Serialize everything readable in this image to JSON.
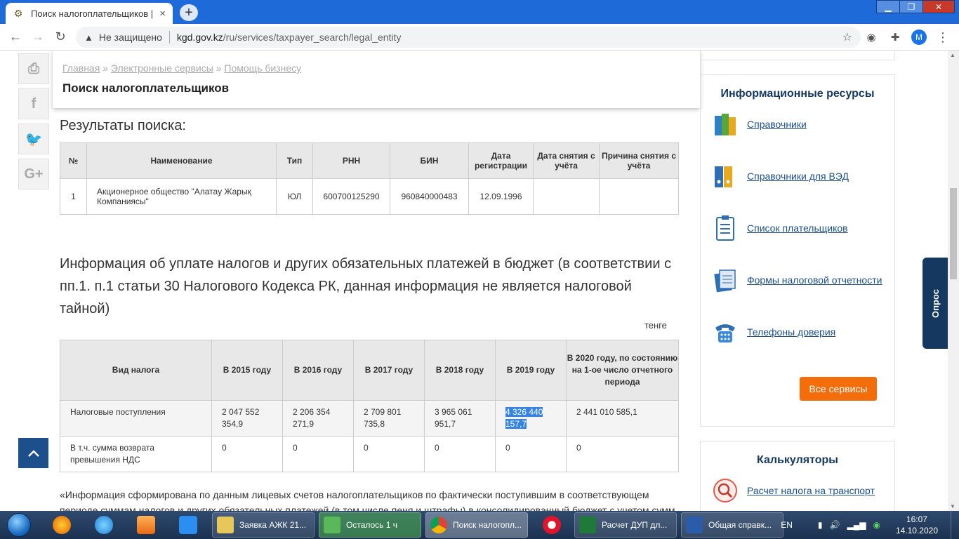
{
  "browser": {
    "tab_title": "Поиск налогоплательщиков | Ко",
    "tab_close": "×",
    "new_tab": "+",
    "not_secure": "Не защищено",
    "url_domain": "kgd.gov.kz",
    "url_path": "/ru/services/taxpayer_search/legal_entity",
    "avatar_letter": "M"
  },
  "header": {
    "breadcrumb": [
      "Главная",
      "Электронные сервисы",
      "Помощь бизнесу"
    ],
    "breadcrumb_sep": "»",
    "title": "Поиск налогоплательщиков"
  },
  "results": {
    "heading": "Результаты поиска:",
    "columns": [
      "№",
      "Наименование",
      "Тип",
      "РНН",
      "БИН",
      "Дата регистрации",
      "Дата снятия с учёта",
      "Причина снятия с учёта"
    ],
    "rows": [
      [
        "1",
        "Акционерное общество \"Алатау Жарық Компаниясы\"",
        "ЮЛ",
        "600700125290",
        "960840000483",
        "12.09.1996",
        "",
        ""
      ]
    ]
  },
  "tax_info": {
    "heading": "Информация об уплате налогов и других обязательных платежей в бюджет (в соответствии с пп.1. п.1 статьи 30 Налогового Кодекса РК, данная информация не является налоговой тайной)",
    "currency": "тенге",
    "columns": [
      "Вид налога",
      "В 2015 году",
      "В 2016 году",
      "В 2017 году",
      "В 2018 году",
      "В 2019 году",
      "В 2020 году, по состоянию на 1-ое число отчетного периода"
    ],
    "rows": [
      [
        "Налоговые поступления",
        "2 047 552 354,9",
        "2 206 354 271,9",
        "2 709 801 735,8",
        "3 965 061 951,7",
        "4 326 440 157,7",
        "2 441 010 585,1"
      ],
      [
        "В т.ч. сумма возврата превышения НДС",
        "0",
        "0",
        "0",
        "0",
        "0",
        "0"
      ]
    ],
    "footnote": "«Информация сформирована по данным лицевых счетов налогоплательщиков по фактически поступившим в соответствующем периоде суммам налогов и других обязательных платежей (в том числе пеня и штрафы) в консолидированный бюджет с учетом сумм"
  },
  "sidebar": {
    "info_title": "Информационные ресурсы",
    "items": [
      "Справочники",
      "Справочники для ВЭД",
      "Список плательщиков",
      "Формы налоговой отчетности",
      "Телефоны доверия"
    ],
    "all_services": "Все сервисы",
    "calc_title": "Калькуляторы",
    "calc_items": [
      "Расчет налога на транспорт"
    ]
  },
  "survey_tab": "Опрос",
  "taskbar": {
    "tasks": [
      "Заявка АЖК 21...",
      "Осталось 1 ч",
      "Поиск налогопл...",
      "Расчет ДУП дл...",
      "Общая справк..."
    ],
    "lang": "EN",
    "time": "16:07",
    "date": "14.10.2020"
  }
}
